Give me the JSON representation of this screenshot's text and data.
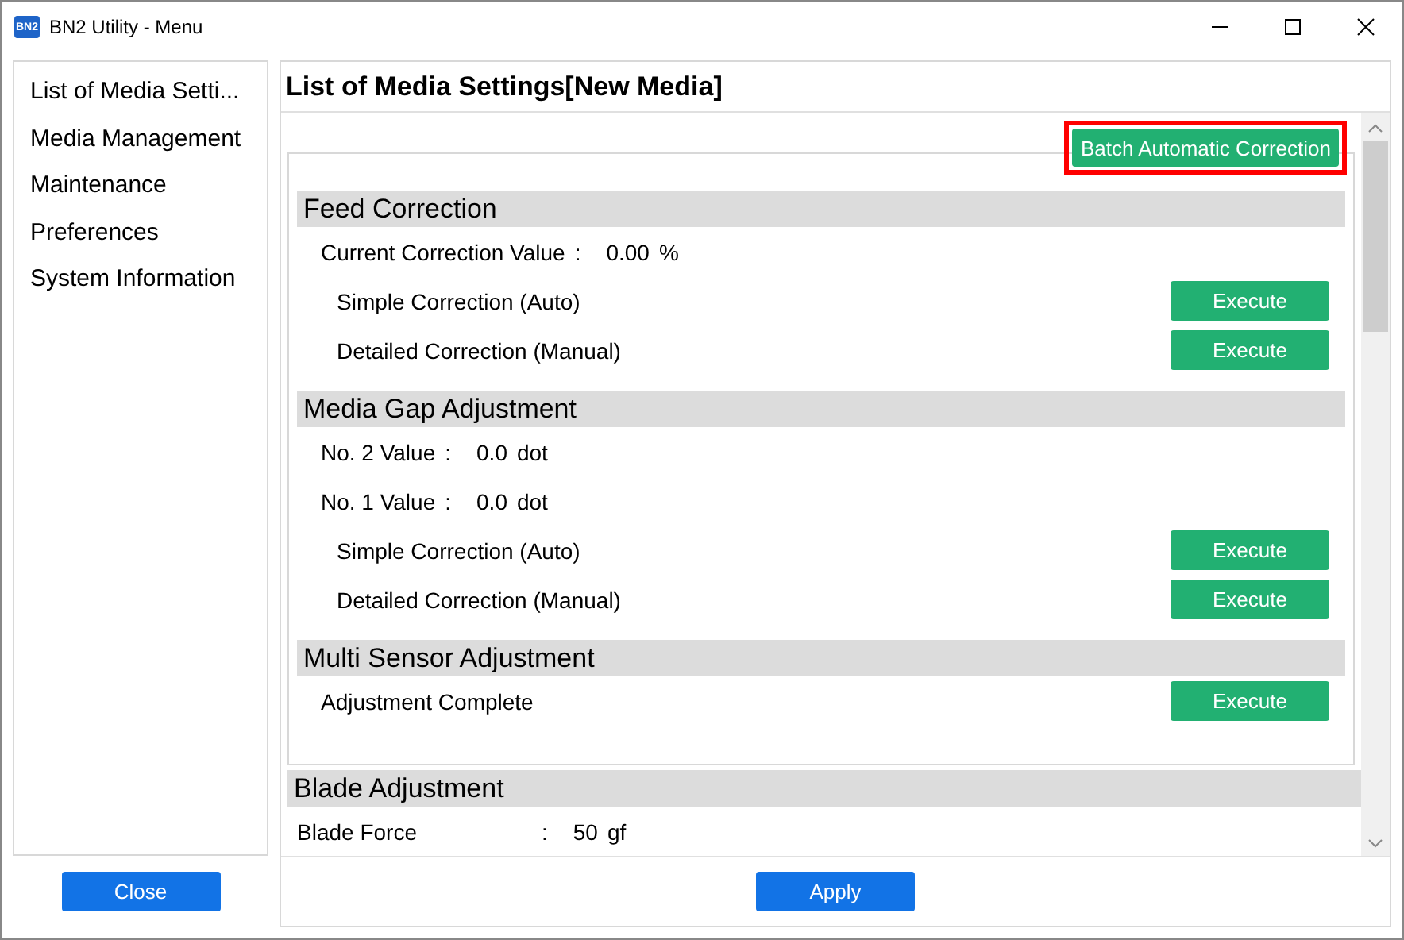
{
  "window": {
    "title": "BN2 Utility - Menu",
    "icon_text": "BN2"
  },
  "sidebar": {
    "items": [
      {
        "label": "List of Media Setti...",
        "selected": false
      },
      {
        "label": "Media Management",
        "selected": false
      },
      {
        "label": "Maintenance",
        "selected": false
      },
      {
        "label": "Preferences",
        "selected": false
      },
      {
        "label": "System Information",
        "selected": false
      }
    ],
    "close_button": "Close"
  },
  "main": {
    "title": "List of Media Settings[New Media]",
    "batch_button": {
      "label": "Batch Automatic Correction",
      "highlighted": true
    },
    "boxed_sections": [
      {
        "title": "Feed Correction",
        "rows": [
          {
            "kind": "value",
            "label": "Current Correction Value",
            "colon": ":",
            "value": "0.00",
            "unit": "%"
          },
          {
            "kind": "action",
            "label": "Simple Correction (Auto)",
            "button": "Execute"
          },
          {
            "kind": "action",
            "label": "Detailed Correction (Manual)",
            "button": "Execute"
          }
        ]
      },
      {
        "title": "Media Gap Adjustment",
        "rows": [
          {
            "kind": "value",
            "label": "No. 2 Value",
            "colon": ":",
            "value": "0.0",
            "unit": "dot"
          },
          {
            "kind": "value",
            "label": "No. 1 Value",
            "colon": ":",
            "value": "0.0",
            "unit": "dot"
          },
          {
            "kind": "action",
            "label": "Simple Correction (Auto)",
            "button": "Execute"
          },
          {
            "kind": "action",
            "label": "Detailed Correction (Manual)",
            "button": "Execute"
          }
        ]
      },
      {
        "title": "Multi Sensor Adjustment",
        "rows": [
          {
            "kind": "status",
            "label": "Adjustment Complete",
            "button": "Execute"
          }
        ]
      }
    ],
    "open_sections": [
      {
        "title": "Blade Adjustment",
        "rows": [
          {
            "kind": "field",
            "label": "Blade Force",
            "colon": ":",
            "value": "50",
            "unit": "gf"
          }
        ]
      }
    ],
    "apply_button": "Apply"
  }
}
